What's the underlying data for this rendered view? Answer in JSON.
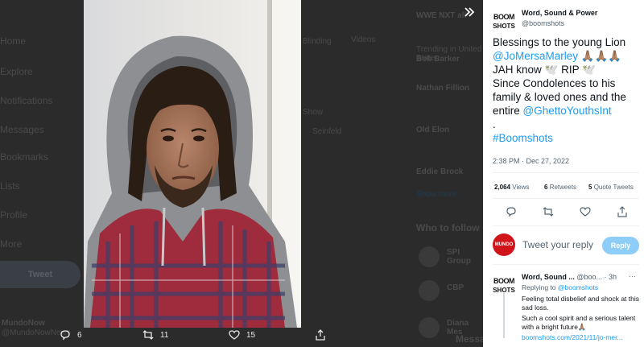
{
  "background": {
    "nav": [
      "Home",
      "Explore",
      "Notifications",
      "Messages",
      "Bookmarks",
      "Lists",
      "Profile",
      "More"
    ],
    "tweet_button": "Tweet",
    "account_name": "MundoNow",
    "account_handle": "@MundoNowNews",
    "trend_top": "WWE NXT all",
    "tab_right": "Videos",
    "trends": [
      {
        "meta": "Trending in United States",
        "name": "Bob Barker"
      },
      {
        "meta": "",
        "name": "Nathan Fillion"
      },
      {
        "meta": "",
        "name": "Old Elon"
      },
      {
        "meta": "",
        "name": "Eddie Brock"
      }
    ],
    "show_more": "Show more",
    "who_to_follow": "Who to follow",
    "follow_suggestions": [
      "SPI Group",
      "CBP",
      "Diana Mes"
    ],
    "messages": "Messa",
    "partial_texts": [
      "Show",
      "Seinfeld",
      "Blinding"
    ]
  },
  "photo": {
    "alt": "Young man with dreadlocks wearing a grey hoodie and plaid shirt"
  },
  "actions": {
    "replies": "6",
    "retweets": "11",
    "likes": "15"
  },
  "tweet": {
    "author_name": "Word, Sound & Power",
    "author_handle": "@boomshots",
    "logo_text_top": "BOOM",
    "logo_text_bottom": "SHOTS",
    "line1": "Blessings to the young Lion",
    "mention1": "@JoMersaMarley",
    "emoji1": "🙏🏽🙏🏽🙏🏽",
    "line2": "JAH know 🕊️ RIP 🕊️",
    "line3": "Since Condolences to his family & loved ones and the entire",
    "mention2": "@GhettoYouthsInt",
    "line4": ".",
    "hashtag": "#Boomshots",
    "timestamp": "2:38 PM · Dec 27, 2022",
    "views_count": "2,064",
    "views_label": "Views",
    "retweets_count": "6",
    "retweets_label": "Retweets",
    "quotes_count": "5",
    "quotes_label": "Quote Tweets"
  },
  "reply_box": {
    "avatar_text": "MUNDO",
    "placeholder": "Tweet your reply",
    "button": "Reply"
  },
  "reply": {
    "author_name": "Word, Sound ...",
    "author_handle": "@boo...",
    "time": "· 3h",
    "more": "···",
    "replying_to_label": "Replying to",
    "replying_to_handle": "@boomshots",
    "line1": "Feeling total disbelief and shock at this sad loss.",
    "line2": "Such a cool spirit and a serious talent with a bright future🙏🏽",
    "link": "boomshots.com/2021/11/jo-mer..."
  }
}
